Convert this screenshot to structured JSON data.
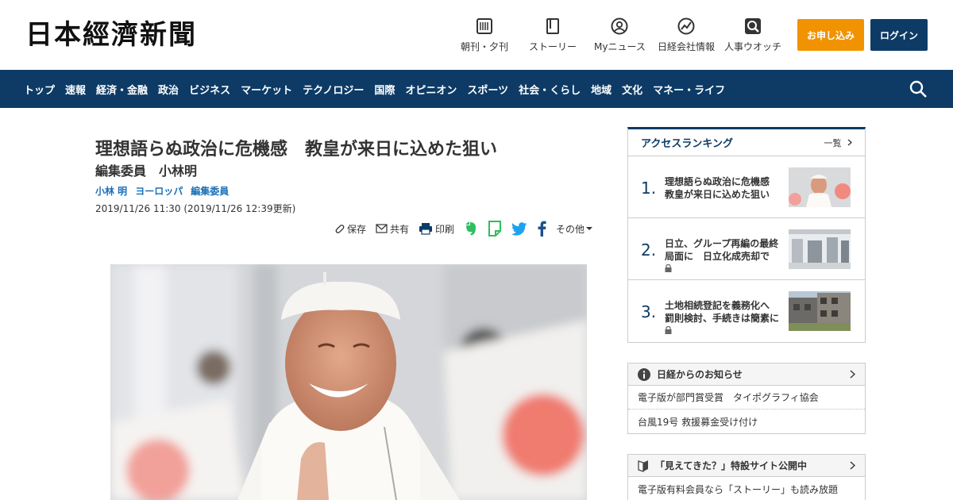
{
  "header": {
    "logo": "日本經濟新聞",
    "nav": [
      {
        "label": "朝刊・夕刊",
        "icon": "newspaper-icon"
      },
      {
        "label": "ストーリー",
        "icon": "book-icon"
      },
      {
        "label": "Myニュース",
        "icon": "user-icon"
      },
      {
        "label": "日経会社情報",
        "icon": "chart-icon"
      },
      {
        "label": "人事ウオッチ",
        "icon": "search-person-icon"
      }
    ],
    "subscribe": "お申し込み",
    "login": "ログイン"
  },
  "navbar": {
    "items": [
      "トップ",
      "速報",
      "経済・金融",
      "政治",
      "ビジネス",
      "マーケット",
      "テクノロジー",
      "国際",
      "オピニオン",
      "スポーツ",
      "社会・くらし",
      "地域",
      "文化",
      "マネー・ライフ"
    ]
  },
  "article": {
    "headline": "理想語らぬ政治に危機感　教皇が来日に込めた狙い",
    "subhead": "編集委員　小林明",
    "authors": [
      "小林 明",
      "ヨーロッパ",
      "編集委員"
    ],
    "date": "2019/11/26 11:30 (2019/11/26 12:39更新)",
    "share": {
      "save": "保存",
      "share": "共有",
      "print": "印刷",
      "more": "その他"
    }
  },
  "ranking": {
    "title": "アクセスランキング",
    "more": "一覧",
    "items": [
      {
        "num": "1.",
        "text": "理想語らぬ政治に危機感　教皇が来日に込めた狙い",
        "locked": false
      },
      {
        "num": "2.",
        "text": "日立、グループ再編の最終局面に　日立化成売却で",
        "locked": true
      },
      {
        "num": "3.",
        "text": "土地相続登記を義務化へ　罰則検討、手続きは簡素に",
        "locked": true
      }
    ]
  },
  "notice1": {
    "title": "日経からのお知らせ",
    "rows": [
      "電子版が部門賞受賞　タイポグラフィ協会",
      "台風19号 救援募金受け付け"
    ]
  },
  "notice2": {
    "title": "「見えてきた？」特設サイト公開中",
    "rows": [
      "電子版有料会員なら「ストーリー」も読み放題"
    ]
  },
  "colors": {
    "brand": "#0d3b66",
    "accent": "#f19300",
    "link": "#1a70b8"
  }
}
